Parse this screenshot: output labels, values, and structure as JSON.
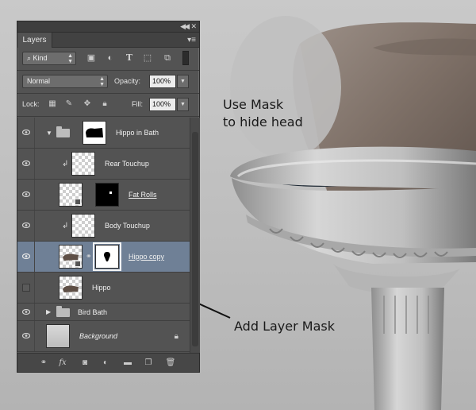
{
  "panel": {
    "tab_label": "Layers",
    "kind_label": "Kind",
    "blend_mode": "Normal",
    "opacity_label": "Opacity:",
    "opacity_value": "100%",
    "lock_label": "Lock:",
    "fill_label": "Fill:",
    "fill_value": "100%"
  },
  "layers": [
    {
      "name": "Hippo in Bath",
      "type": "group-open",
      "visible": true
    },
    {
      "name": "Rear Touchup",
      "type": "clipped",
      "visible": true
    },
    {
      "name": "Fat Rolls",
      "type": "masked",
      "visible": true
    },
    {
      "name": "Body Touchup",
      "type": "clipped",
      "visible": true
    },
    {
      "name": "Hippo copy",
      "type": "masked-linked",
      "visible": true,
      "selected": true
    },
    {
      "name": "Hippo",
      "type": "pixel",
      "visible": false
    },
    {
      "name": "Bird Bath",
      "type": "group-closed",
      "visible": true
    },
    {
      "name": "Background",
      "type": "background",
      "visible": true,
      "locked": true
    }
  ],
  "annotations": {
    "mask_line1": "Use Mask",
    "mask_line2": "to hide head",
    "add_mask": "Add Layer Mask"
  },
  "bottom_bar": {
    "fx_label": "fx"
  }
}
